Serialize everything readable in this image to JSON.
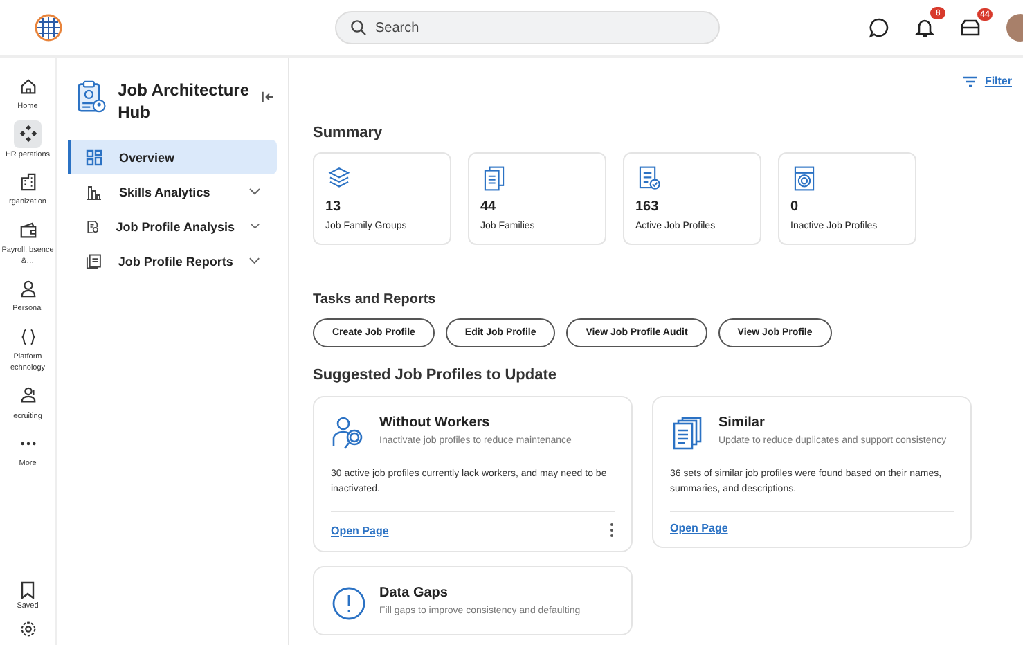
{
  "header": {
    "search": {
      "placeholder": "Search"
    },
    "notifications_badge": "8",
    "inbox_badge": "44"
  },
  "rail": [
    {
      "label": "Home",
      "selected": false
    },
    {
      "label": "HR perations",
      "selected": true
    },
    {
      "label": "rganization",
      "selected": false
    },
    {
      "label": "Payroll, bsence &…",
      "selected": false
    },
    {
      "label": "Personal",
      "selected": false
    },
    {
      "label": "Platform echnology",
      "selected": false
    },
    {
      "label": "ecruiting",
      "selected": false
    },
    {
      "label": "More",
      "selected": false
    }
  ],
  "rail_bottom": [
    {
      "label": "Saved"
    }
  ],
  "nav": {
    "title": "Job Architecture Hub",
    "items": [
      {
        "label": "Overview",
        "kind": "page",
        "selected": true
      },
      {
        "label": "Skills Analytics",
        "kind": "group",
        "selected": false
      },
      {
        "label": "Job Profile Analysis",
        "kind": "group",
        "selected": false
      },
      {
        "label": "Job Profile Reports",
        "kind": "group",
        "selected": false
      }
    ]
  },
  "filter": "Filter",
  "summary": {
    "title": "Summary",
    "cards": [
      {
        "value": "13",
        "label": "Job Family Groups"
      },
      {
        "value": "44",
        "label": "Job Families"
      },
      {
        "value": "163",
        "label": "Active Job Profiles"
      },
      {
        "value": "0",
        "label": "Inactive Job Profiles"
      }
    ]
  },
  "tasks": {
    "title": "Tasks and Reports",
    "buttons": [
      "Create Job Profile",
      "Edit Job Profile",
      "View Job Profile Audit",
      "View Job Profile"
    ]
  },
  "suggested": {
    "title": "Suggested Job Profiles to Update",
    "cards": [
      {
        "title": "Without Workers",
        "subtitle": "Inactivate job profiles to reduce maintenance",
        "body": "30 active job profiles currently lack workers, and may need to be inactivated.",
        "link": "Open Page",
        "more_menu": true
      },
      {
        "title": "Similar",
        "subtitle": "Update to reduce duplicates and support consistency",
        "body": "36 sets of similar job profiles were found based on their names, summaries, and descriptions.",
        "link": "Open Page",
        "more_menu": false
      },
      {
        "title": "Data Gaps",
        "subtitle": "Fill gaps to improve consistency and defaulting"
      }
    ]
  }
}
